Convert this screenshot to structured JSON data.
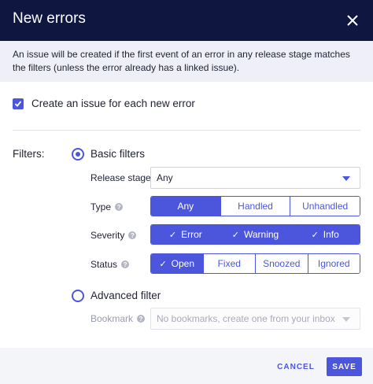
{
  "dialog": {
    "title": "New errors",
    "close_icon": "close-icon",
    "info_text": "An issue will be created if the first event of an error in any release stage matches the filters (unless the error already has a linked issue)."
  },
  "create_issue": {
    "label": "Create an issue for each new error",
    "checked": true
  },
  "filters": {
    "label": "Filters:",
    "basic": {
      "label": "Basic filters",
      "selected": true
    },
    "release_stage": {
      "label": "Release stage",
      "value": "Any"
    },
    "type": {
      "label": "Type",
      "options": [
        "Any",
        "Handled",
        "Unhandled"
      ],
      "selected": [
        "Any"
      ]
    },
    "severity": {
      "label": "Severity",
      "options": [
        "Error",
        "Warning",
        "Info"
      ],
      "selected": [
        "Error",
        "Warning",
        "Info"
      ]
    },
    "status": {
      "label": "Status",
      "options": [
        "Open",
        "Fixed",
        "Snoozed",
        "Ignored"
      ],
      "selected": [
        "Open"
      ]
    },
    "advanced": {
      "label": "Advanced filter",
      "selected": false
    },
    "bookmark": {
      "label": "Bookmark",
      "placeholder": "No bookmarks, create one from your inbox"
    }
  },
  "footer": {
    "cancel_label": "CANCEL",
    "save_label": "SAVE"
  },
  "colors": {
    "header": "#0f1740",
    "accent": "#4c56dc",
    "info_bg": "#eeeff8"
  }
}
